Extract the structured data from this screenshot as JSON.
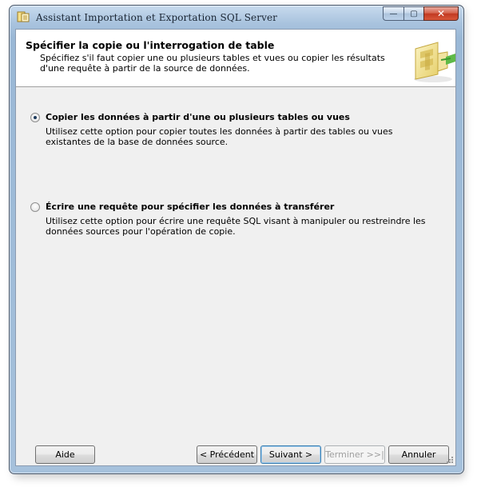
{
  "window": {
    "title": "Assistant Importation et Exportation SQL Server",
    "minimize_glyph": "—",
    "maximize_glyph": "▢",
    "close_glyph": "✕"
  },
  "header": {
    "title": "Spécifier la copie ou l'interrogation de table",
    "description": "Spécifiez s'il faut copier une ou plusieurs tables et vues ou copier les résultats d'une requête à partir de la source de données.",
    "graphic_icon": "wizard-table-icon"
  },
  "options": [
    {
      "label": "Copier les données à partir d'une ou plusieurs tables ou vues",
      "description": "Utilisez cette option pour copier toutes les données à partir des tables ou vues existantes de la base de données source.",
      "selected": true
    },
    {
      "label": "Écrire une requête pour spécifier les données à transférer",
      "description": "Utilisez cette option pour écrire une requête SQL visant à manipuler ou restreindre les données sources pour l'opération de copie.",
      "selected": false
    }
  ],
  "buttons": {
    "help": "Aide",
    "back": "< Précédent",
    "next": "Suivant >",
    "finish": "Terminer >>|",
    "cancel": "Annuler"
  },
  "colors": {
    "accent": "#3c7fb1",
    "close_red": "#c23a22"
  }
}
